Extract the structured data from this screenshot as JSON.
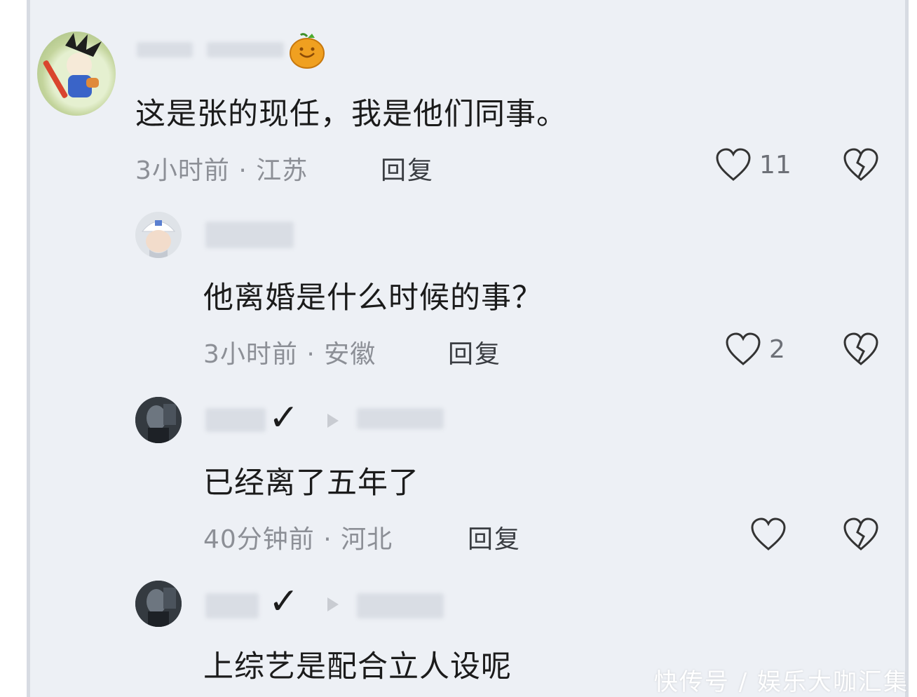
{
  "comments": [
    {
      "text": "这是张的现任，我是他们同事。",
      "time": "3小时前 · 江苏",
      "reply": "回复",
      "likes": "11"
    },
    {
      "text": "他离婚是什么时候的事？",
      "time": "3小时前 · 安徽",
      "reply": "回复",
      "likes": "2"
    },
    {
      "text": "已经离了五年了",
      "time": "40分钟前 · 河北",
      "reply": "回复",
      "likes": ""
    },
    {
      "text": "上综艺是配合立人设呢"
    }
  ],
  "watermark": "快传号 / 娱乐大咖汇集",
  "icons": {
    "like": "heart-outline-icon",
    "dislike": "broken-heart-icon",
    "badge": "orange-badge-icon",
    "verified": "checkmark-icon",
    "reply_arrow": "triangle-right-icon"
  }
}
